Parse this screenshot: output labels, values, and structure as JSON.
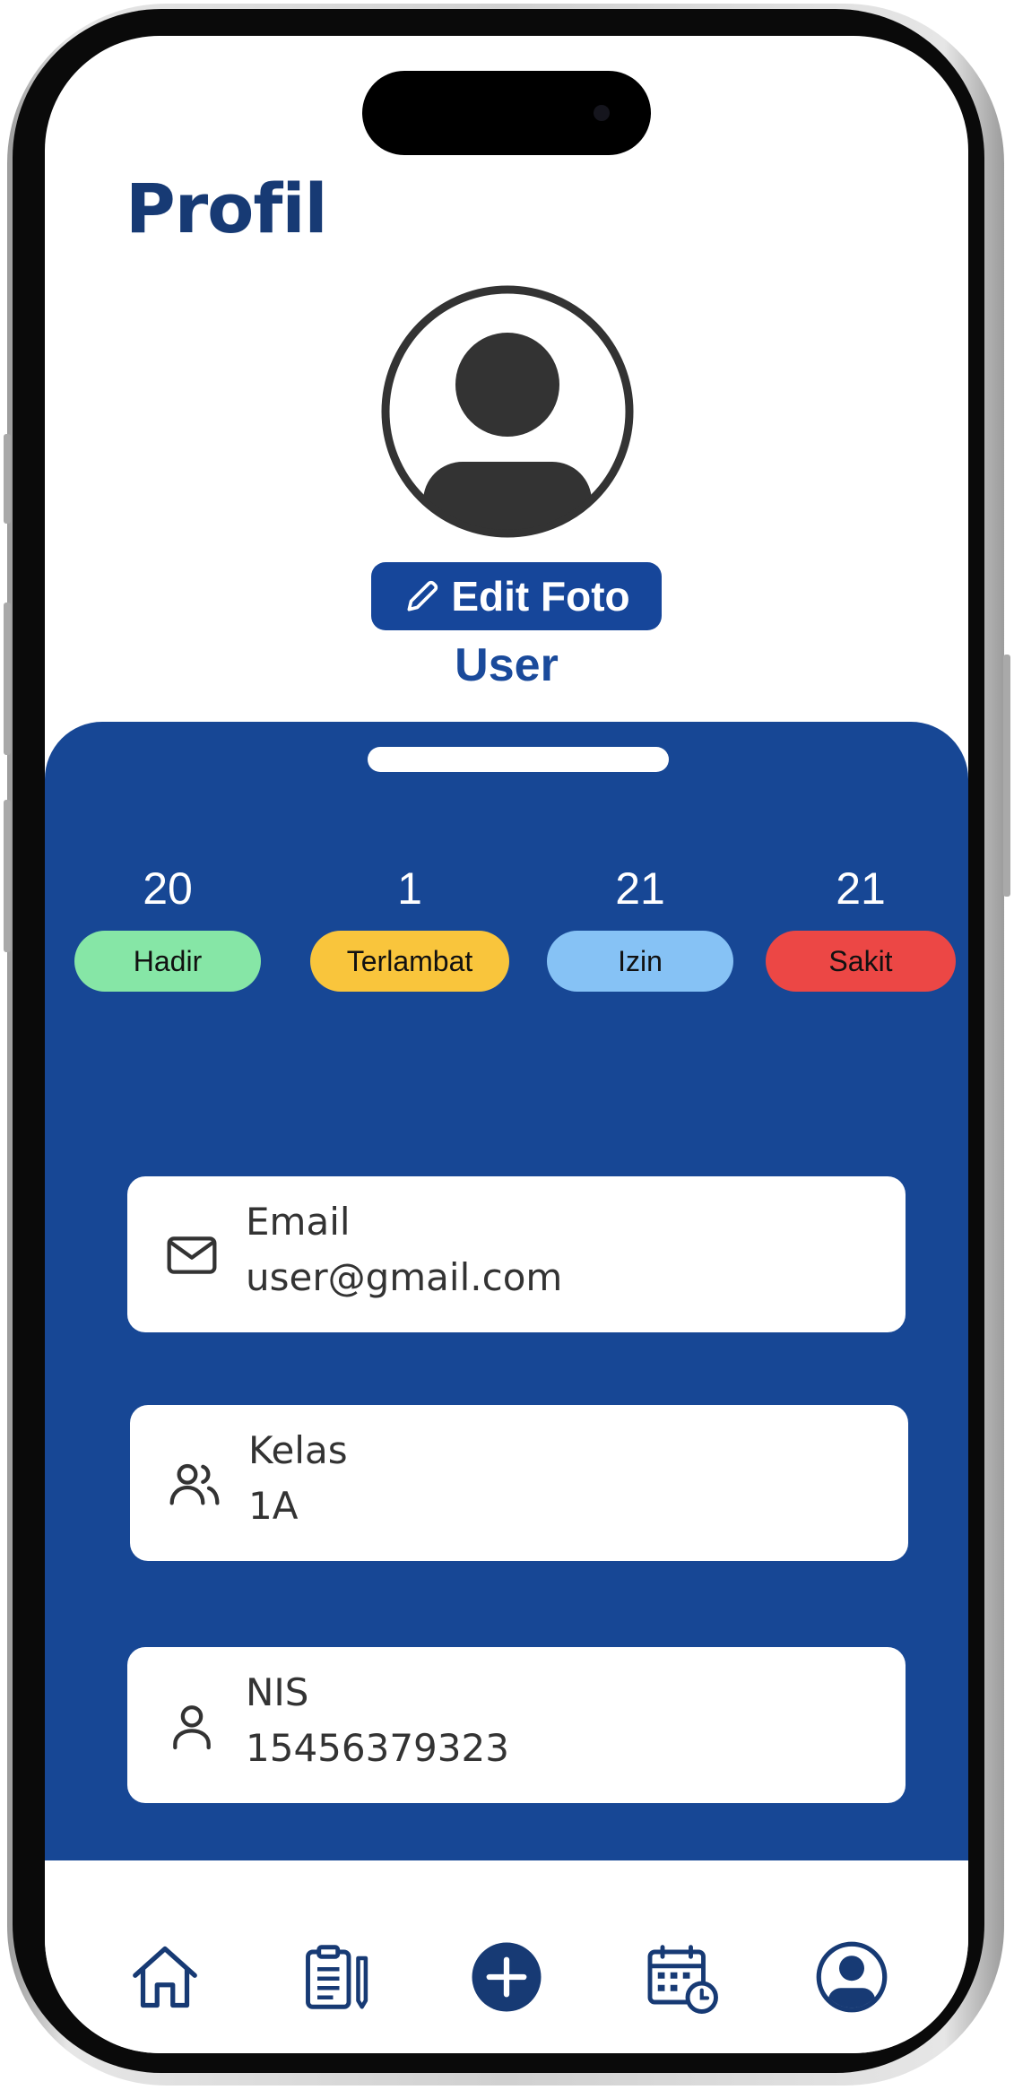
{
  "colors": {
    "primary": "#174795",
    "title": "#173a74",
    "hadir": "#86e6a6",
    "terlambat": "#f9c53c",
    "izin": "#86c2f5",
    "sakit": "#ec4745"
  },
  "page": {
    "title": "Profil"
  },
  "profile": {
    "avatar_icon": "user-avatar-icon",
    "edit_photo_label": "Edit Foto",
    "edit_photo_icon": "pencil-icon",
    "username": "User"
  },
  "stats": [
    {
      "count": "20",
      "label": "Hadir"
    },
    {
      "count": "1",
      "label": "Terlambat"
    },
    {
      "count": "21",
      "label": "Izin"
    },
    {
      "count": "21",
      "label": "Sakit"
    }
  ],
  "info": [
    {
      "icon": "mail-icon",
      "label": "Email",
      "value": "user@gmail.com"
    },
    {
      "icon": "users-icon",
      "label": "Kelas",
      "value": "1A"
    },
    {
      "icon": "user-icon",
      "label": "NIS",
      "value": "15456379323"
    }
  ],
  "nav": [
    {
      "icon": "home-icon"
    },
    {
      "icon": "clipboard-edit-icon"
    },
    {
      "icon": "plus-circle-icon"
    },
    {
      "icon": "calendar-clock-icon"
    },
    {
      "icon": "profile-icon"
    }
  ]
}
